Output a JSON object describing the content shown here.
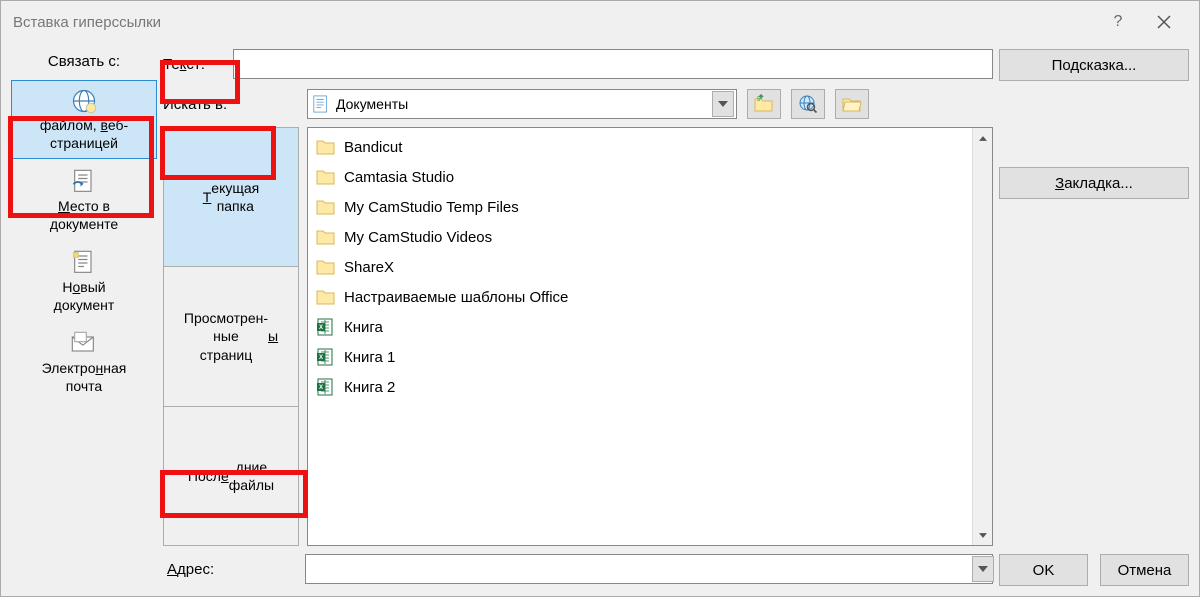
{
  "titlebar": {
    "title": "Вставка гиперссылки"
  },
  "linkto": {
    "label": "Связать с:",
    "items": [
      {
        "label_html": "файлом, веб-\nстраницей"
      },
      {
        "label_html": "Место в\nдокументе"
      },
      {
        "label_html": "Новый\nдокумент"
      },
      {
        "label_html": "Электронная\nпочта"
      }
    ]
  },
  "text_row": {
    "label": "Текст:",
    "value": ""
  },
  "browse": {
    "label": "Искать в:",
    "current": "Документы"
  },
  "view_tabs": [
    "Текущая\nпапка",
    "Просмотрен-\nные\nстраницы",
    "Последние\nфайлы"
  ],
  "files": [
    {
      "type": "folder",
      "name": "Bandicut"
    },
    {
      "type": "folder",
      "name": "Camtasia Studio"
    },
    {
      "type": "folder",
      "name": "My CamStudio Temp Files"
    },
    {
      "type": "folder",
      "name": "My CamStudio Videos"
    },
    {
      "type": "folder",
      "name": "ShareX"
    },
    {
      "type": "folder",
      "name": "Настраиваемые шаблоны Office"
    },
    {
      "type": "xlsx",
      "name": "Книга"
    },
    {
      "type": "xlsx",
      "name": "Книга 1"
    },
    {
      "type": "xlsx",
      "name": "Книга 2"
    }
  ],
  "address": {
    "label": "Адрес:",
    "value": ""
  },
  "buttons": {
    "screentip": "Подсказка...",
    "bookmark": "Закладка...",
    "ok": "OK",
    "cancel": "Отмена"
  }
}
